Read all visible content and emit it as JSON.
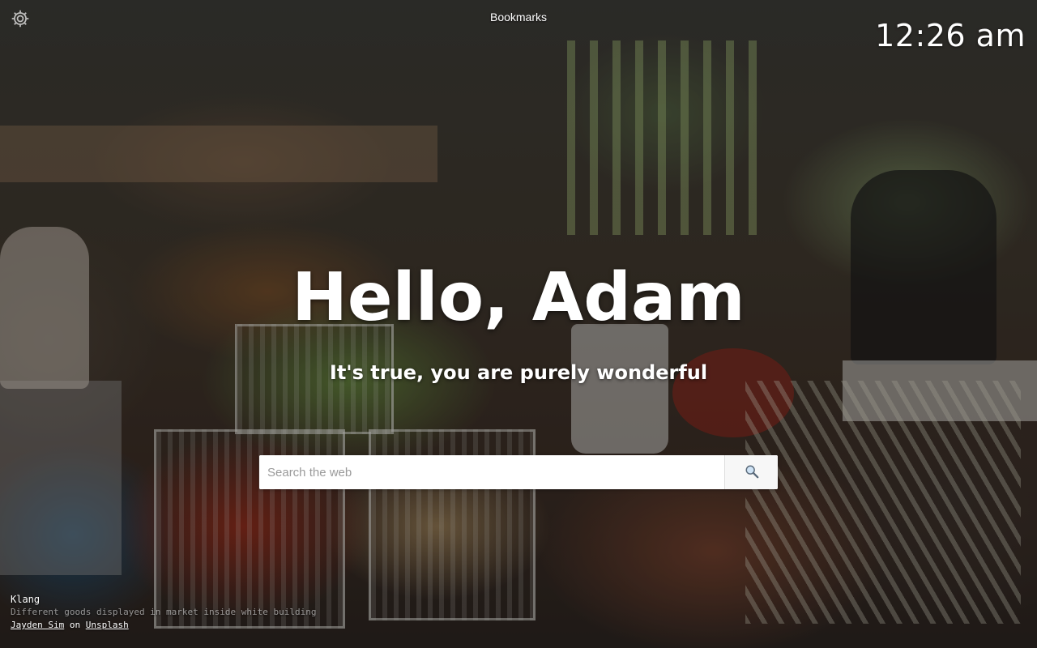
{
  "header": {
    "bookmarks_label": "Bookmarks",
    "clock": "12:26 am"
  },
  "settings": {
    "icon": "gear-icon"
  },
  "greeting": {
    "title": "Hello, Adam",
    "tagline": "It's true, you are purely wonderful"
  },
  "search": {
    "placeholder": "Search the web",
    "value": "",
    "button_icon": "search-icon"
  },
  "credit": {
    "location": "Klang",
    "description": "Different goods displayed in market inside white building",
    "photographer": "Jayden Sim",
    "separator": "on",
    "source": "Unsplash"
  }
}
